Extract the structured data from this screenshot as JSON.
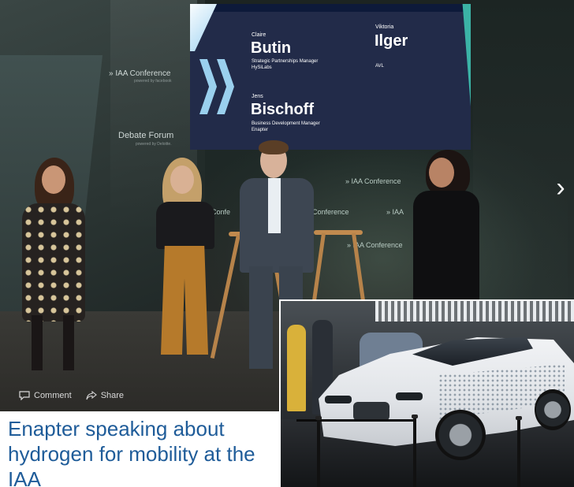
{
  "screen": {
    "speaker1": {
      "first": "Claire",
      "last": "Butin",
      "role1": "Strategic Partnerships Manager",
      "role2": "HySiLabs"
    },
    "speaker2": {
      "first": "Viktoria",
      "last": "Ilger",
      "org": "AVL"
    },
    "speaker3": {
      "first": "Jens",
      "last": "Bischoff",
      "role1": "Business Development Manager",
      "role2": "Enapter"
    }
  },
  "booth": {
    "conference_title": "» IAA Conference",
    "conference_sub": "powered by facebook",
    "forum_title": "Debate Forum",
    "forum_sub": "powered by Deloitte.",
    "floor_texts": [
      "» IAA Conference",
      "Conference",
      "» IAA",
      "» IAA Conference",
      "Confe"
    ]
  },
  "nav": {
    "next_label": "›"
  },
  "social": {
    "comment_label": "Comment",
    "share_label": "Share"
  },
  "caption": "Enapter speaking about hydrogen for mobility at the IAA",
  "colors": {
    "caption": "#1f5c99",
    "screen_bg": "#222b49",
    "accent": "#9ad0ee"
  }
}
